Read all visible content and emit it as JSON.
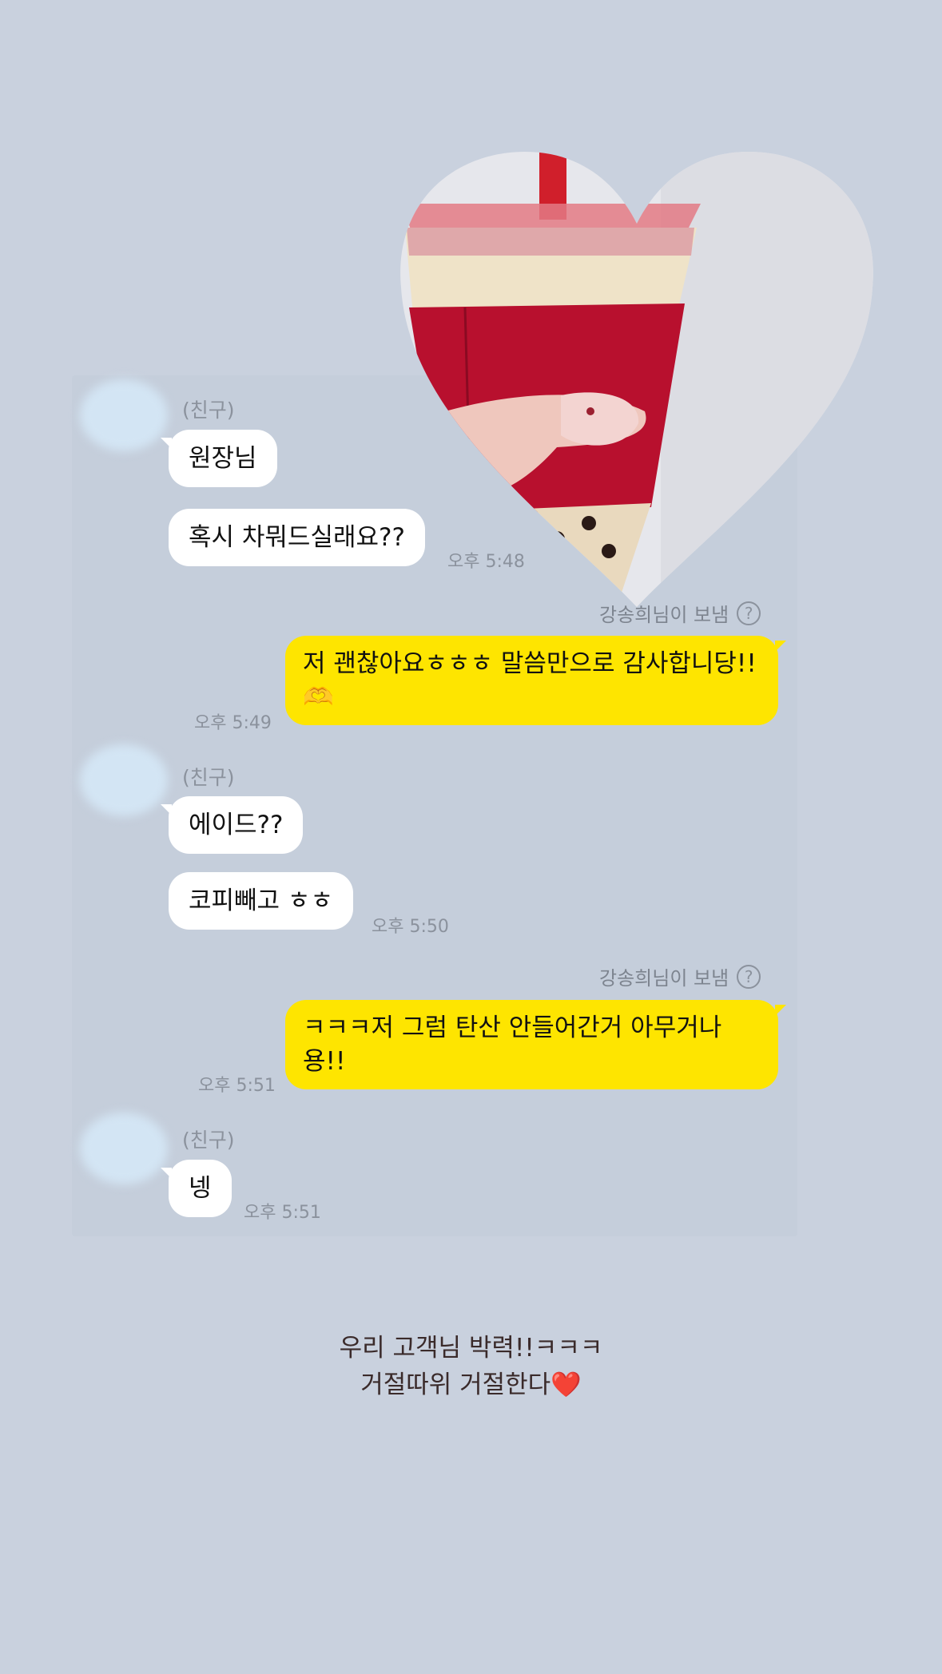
{
  "conversation": {
    "friend_name_1": "(친구)",
    "friend_name_2": "(친구)",
    "friend_name_3": "(친구)",
    "msg1": "원장님",
    "msg2": "혹시 차뭐드실래요??",
    "time1": "오후 5:48",
    "sent_by_1": "강송희님이 보냄",
    "reply1": "저 괜찮아요ㅎㅎㅎ 말씀만으로 감사합니당!!🫶",
    "time2": "오후 5:49",
    "msg3": "에이드??",
    "msg4": "코피빼고 ㅎㅎ",
    "time3": "오후 5:50",
    "sent_by_2": "강송희님이 보냄",
    "reply2": "ㅋㅋㅋ저 그럼 탄산 안들어간거 아무거나용!!",
    "time4": "오후 5:51",
    "msg5": "넹",
    "time5": "오후 5:51",
    "help_icon": "?"
  },
  "caption": {
    "line1": "우리 고객님 박력!!ㅋㅋㅋ",
    "line2": "거절따위 거절한다❤️"
  },
  "icons": {
    "avatar": "avatar-blurred",
    "help": "question-circle-icon",
    "sticker": "heart-photo-bubble-tea"
  },
  "colors": {
    "background": "#c9d1de",
    "my_bubble": "#fee500",
    "friend_bubble": "#ffffff",
    "cup_sleeve": "#b8102e"
  }
}
